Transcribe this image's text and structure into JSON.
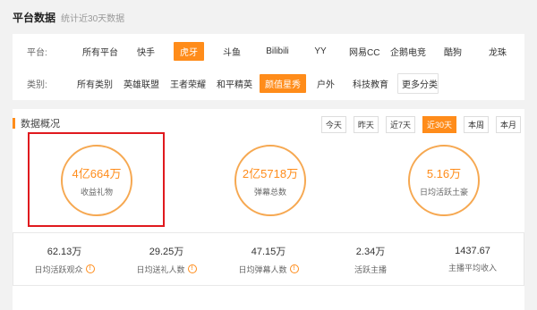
{
  "header": {
    "title": "平台数据",
    "subtitle": "统计近30天数据"
  },
  "filters": {
    "platform_label": "平台:",
    "platforms": [
      {
        "label": "所有平台",
        "active": false
      },
      {
        "label": "快手",
        "active": false
      },
      {
        "label": "虎牙",
        "active": true
      },
      {
        "label": "斗鱼",
        "active": false
      },
      {
        "label": "Bilibili",
        "active": false
      },
      {
        "label": "YY",
        "active": false
      },
      {
        "label": "网易CC",
        "active": false
      },
      {
        "label": "企鹅电竞",
        "active": false
      },
      {
        "label": "酷狗",
        "active": false
      },
      {
        "label": "龙珠",
        "active": false
      }
    ],
    "category_label": "类别:",
    "categories": [
      {
        "label": "所有类别",
        "active": false
      },
      {
        "label": "英雄联盟",
        "active": false
      },
      {
        "label": "王者荣耀",
        "active": false
      },
      {
        "label": "和平精英",
        "active": false
      },
      {
        "label": "颜值星秀",
        "active": true
      },
      {
        "label": "户外",
        "active": false
      },
      {
        "label": "科技教育",
        "active": false
      },
      {
        "label": "更多分类",
        "active": false
      }
    ]
  },
  "overview": {
    "title": "数据概况",
    "ranges": [
      {
        "label": "今天",
        "active": false
      },
      {
        "label": "昨天",
        "active": false
      },
      {
        "label": "近7天",
        "active": false
      },
      {
        "label": "近30天",
        "active": true
      },
      {
        "label": "本周",
        "active": false
      },
      {
        "label": "本月",
        "active": false
      }
    ],
    "highlights": [
      {
        "value": "4亿664万",
        "label": "收益礼物"
      },
      {
        "value": "2亿5718万",
        "label": "弹幕总数"
      },
      {
        "value": "5.16万",
        "label": "日均活跃土豪"
      }
    ],
    "stats": [
      {
        "value": "62.13万",
        "label": "日均活跃观众",
        "info": true
      },
      {
        "value": "29.25万",
        "label": "日均送礼人数",
        "info": true
      },
      {
        "value": "47.15万",
        "label": "日均弹幕人数",
        "info": true
      },
      {
        "value": "2.34万",
        "label": "活跃主播",
        "info": false
      },
      {
        "value": "1437.67",
        "label": "主播平均收入",
        "info": false
      }
    ]
  },
  "colors": {
    "accent": "#ff8c1a",
    "highlight_box": "#e0191e",
    "circle_border": "#f6a851"
  }
}
